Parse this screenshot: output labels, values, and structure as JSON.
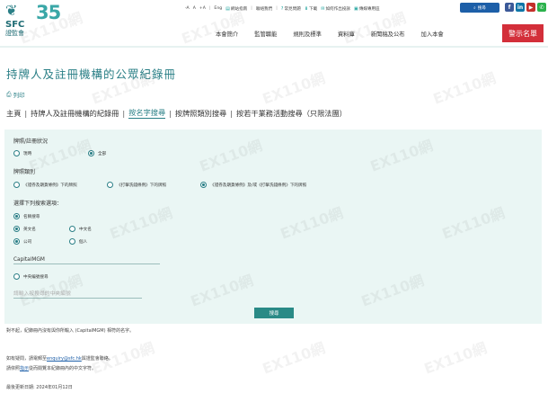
{
  "logo": {
    "number": "35",
    "short": "SFC",
    "cn": "證監會"
  },
  "utility_bar": {
    "font_controls": [
      "-A",
      "A",
      "+A"
    ],
    "lang_en": "Eng",
    "links": [
      "網站指南",
      "聯絡我們",
      "常見問題",
      "下載",
      "如何作出投訴",
      "傳媒專用區"
    ]
  },
  "search_button": "搜尋",
  "main_nav": [
    "本會簡介",
    "監管職能",
    "規則及標準",
    "資料庫",
    "新聞稿及公布",
    "加入本會"
  ],
  "blacklist_button": "警示名單",
  "page_title": "持牌人及註冊機構的公眾紀錄冊",
  "print_label": "列印",
  "breadcrumb": [
    "主頁",
    "持牌人及註冊機構的紀錄冊",
    "按名字搜尋",
    "按牌照類別搜尋",
    "按若干業務活動搜尋（只限法團）"
  ],
  "form": {
    "status_label": "牌照/註冊狀況",
    "status_options": [
      {
        "label": "現時",
        "selected": false
      },
      {
        "label": "全部",
        "selected": true
      }
    ],
    "license_label": "牌照類別",
    "license_options": [
      {
        "label": "《證券及期貨條例》下的牌照",
        "selected": false
      },
      {
        "label": "《打擊洗錢條例》下的牌照",
        "selected": false
      },
      {
        "label": "《證券及期貨條例》及/或《打擊洗錢條例》下的牌照",
        "selected": true
      }
    ],
    "choose_label": "選擇下列搜索選項：",
    "by_name": {
      "label": "名稱搜尋",
      "selected": true
    },
    "name_lang": [
      {
        "label": "英文名",
        "selected": true
      },
      {
        "label": "中文名",
        "selected": false
      }
    ],
    "entity_type": [
      {
        "label": "公司",
        "selected": true
      },
      {
        "label": "個人",
        "selected": false
      }
    ],
    "name_value": "CapitalMGM",
    "by_ce": {
      "label": "中央編號搜尋",
      "selected": false
    },
    "ce_placeholder": "請輸入按搜尋的中央編號",
    "submit_label": "搜尋"
  },
  "result_note": "對不起，紀錄冊內沒有與你所輸入 (CapitalMGM) 相符的名字。",
  "enquiry": {
    "prefix": "如有疑問，請電郵至",
    "email": "enquiry@sfc.hk",
    "suffix": "與證監會聯絡。"
  },
  "refer": {
    "prefix": "請依照",
    "link": "指示",
    "suffix": "從而閱覽本紀錄冊內的中文字符。"
  },
  "last_updated": "最後更新日期: 2024年01月12日",
  "watermark": "EX110網",
  "colors": {
    "brand": "#2a7f86",
    "panel": "#eaf6f4",
    "alert": "#d32f3a",
    "search": "#1d5fa8"
  }
}
